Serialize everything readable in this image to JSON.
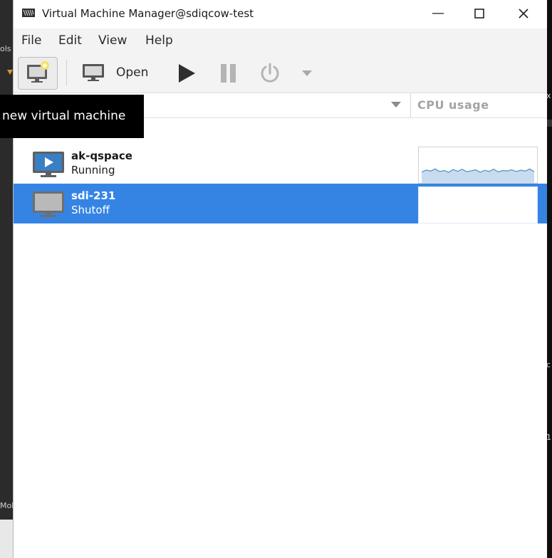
{
  "window": {
    "title": "Virtual Machine Manager@sdiqcow-test",
    "controls": {
      "minimize": "—",
      "maximize": "☐",
      "close": "✕"
    }
  },
  "menu": [
    "File",
    "Edit",
    "View",
    "Help"
  ],
  "toolbar": {
    "new_vm_icon": "new-vm-monitor-icon",
    "open_label": "Open",
    "run_icon": "play-icon",
    "pause_icon": "pause-icon",
    "shutdown_icon": "power-icon",
    "more_icon": "dropdown-arrow-icon"
  },
  "tooltip": {
    "text": "new virtual machine"
  },
  "columns": {
    "cpu_usage": "CPU usage"
  },
  "vms": [
    {
      "name": "ak-qspace",
      "status": "Running",
      "icon": "running-vm-icon",
      "selected": false
    },
    {
      "name": "sdi-231",
      "status": "Shutoff",
      "icon": "shutoff-vm-icon",
      "selected": true
    }
  ],
  "colors": {
    "selection": "#3584e4",
    "graph_line": "#5a93c4",
    "graph_fill": "#c9dcef",
    "toolbar_bg": "#f3f3f3"
  },
  "background_fragments": {
    "left_top": "ols",
    "left_bottom": "Mob",
    "right_1": "x",
    "right_2": "c",
    "right_3": "1"
  }
}
